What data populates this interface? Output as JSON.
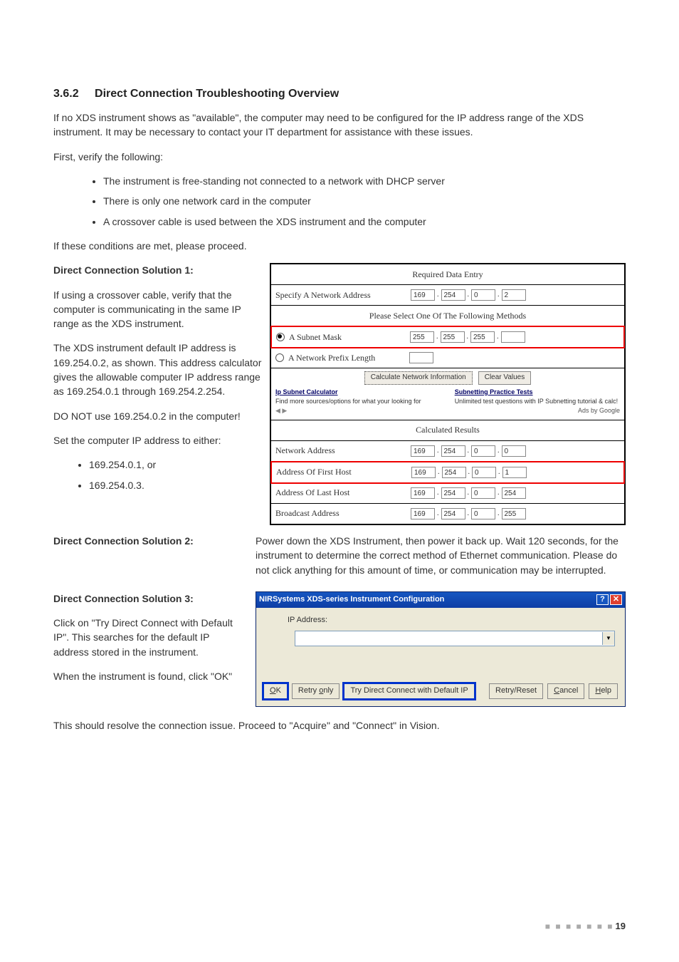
{
  "section_number": "3.6.2",
  "section_title": "Direct Connection Troubleshooting Overview",
  "intro1": "If no XDS instrument shows as \"available\", the computer may need to be configured for the IP address range of the XDS instrument. It may be necessary to contact your IT department for assistance with these issues.",
  "intro2": "First, verify the following:",
  "verify_list": [
    "The instrument is free-standing not connected to a network with DHCP server",
    "There is only one network card in the computer",
    "A crossover cable is used between the XDS instrument and the computer"
  ],
  "intro3": "If these conditions are met, please proceed.",
  "sol1_heading": "Direct Connection Solution 1:",
  "sol1_p1": "If using a crossover cable, verify that the computer is communicating in the same IP range as the XDS instrument.",
  "sol1_p2": "The XDS instrument default IP address is 169.254.0.2, as shown. This address calculator gives the allowable computer IP address range as 169.254.0.1 through 169.254.2.254.",
  "sol1_p3": "DO NOT use 169.254.0.2 in the computer!",
  "sol1_p4": "Set the computer IP address to either:",
  "sol1_options": [
    "169.254.0.1, or",
    "169.254.0.3."
  ],
  "calc": {
    "hdr1": "Required Data Entry",
    "specify_label": "Specify A Network Address",
    "specify_vals": [
      "169",
      "254",
      "0",
      "2"
    ],
    "hdr2": "Please Select One Of The Following Methods",
    "subnet_label": "A Subnet Mask",
    "subnet_vals": [
      "255",
      "255",
      "255",
      ""
    ],
    "prefix_label": "A Network Prefix Length",
    "prefix_val": "",
    "btn_calc": "Calculate Network Information",
    "btn_clear": "Clear Values",
    "ad_left_title": "Ip Subnet Calculator",
    "ad_left_sub": "Find more sources/options for what your looking for",
    "ad_right_title": "Subnetting Practice Tests",
    "ad_right_sub": "Unlimited test questions with IP Subnetting tutorial & calc!",
    "ads_by": "Ads by Google",
    "hdr3": "Calculated Results",
    "results": [
      {
        "label": "Network Address",
        "vals": [
          "169",
          "254",
          "0",
          "0"
        ]
      },
      {
        "label": "Address Of First Host",
        "vals": [
          "169",
          "254",
          "0",
          "1"
        ],
        "hl": true
      },
      {
        "label": "Address Of Last Host",
        "vals": [
          "169",
          "254",
          "0",
          "254"
        ]
      },
      {
        "label": "Broadcast Address",
        "vals": [
          "169",
          "254",
          "0",
          "255"
        ]
      }
    ]
  },
  "sol2_heading": "Direct Connection Solution 2:",
  "sol2_body": "Power down the XDS Instrument, then power it back up. Wait 120 seconds, for the instrument to determine the correct method of Ethernet communication. Please do not click anything for this amount of time, or communication may be interrupted.",
  "sol3_heading": "Direct Connection Solution 3:",
  "sol3_p1": "Click on \"Try Direct Connect with Default IP\". This searches for the default IP address stored in the instrument.",
  "sol3_p2": "When the instrument is found, click \"OK\"",
  "dlg": {
    "title": "NIRSystems XDS-series Instrument Configuration",
    "ip_label": "IP Address:",
    "buttons": {
      "ok": "OK",
      "retry_only": "Retry only",
      "try_direct": "Try Direct Connect with Default IP",
      "retry_reset": "Retry/Reset",
      "cancel": "Cancel",
      "help": "Help"
    }
  },
  "closing": "This should resolve the connection issue. Proceed to \"Acquire\" and \"Connect\" in Vision.",
  "page_number": "19"
}
